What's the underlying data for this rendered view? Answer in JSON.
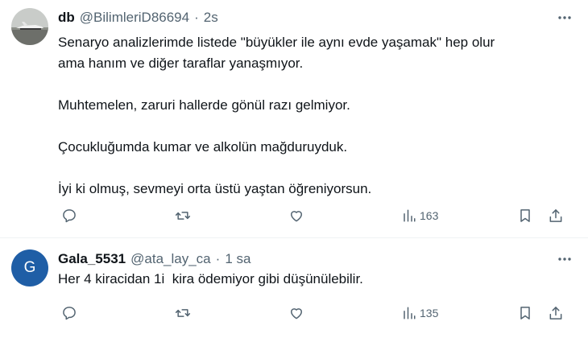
{
  "tweets": [
    {
      "display_name": "db",
      "handle": "@BilimleriD86694",
      "separator": "·",
      "time": "2s",
      "lines": [
        "Senaryo analizlerimde listede \"büyükler ile aynı evde yaşamak\" hep olur",
        "ama hanım ve diğer taraflar yanaşmıyor.",
        "",
        "Muhtemelen, zaruri hallerde gönül razı gelmiyor.",
        "",
        "Çocukluğumda kumar ve alkolün mağduruyduk.",
        "",
        "İyi ki olmuş, sevmeyi orta üstü yaştan öğreniyorsun."
      ],
      "views": "163"
    },
    {
      "display_name": "Gala_5531",
      "handle": "@ata_lay_ca",
      "separator": "·",
      "time": "1 sa",
      "avatar_letter": "G",
      "lines": [
        "Her 4 kiracidan 1i  kira ödemiyor gibi düşünülebilir."
      ],
      "views": "135"
    }
  ],
  "colors": {
    "text": "#0f1419",
    "secondary": "#536471",
    "avatar_g": "#1f5ea6",
    "divider": "#eff3f4"
  },
  "icons": [
    "more-icon",
    "reply-icon",
    "retweet-icon",
    "like-icon",
    "views-icon",
    "bookmark-icon",
    "share-icon"
  ]
}
